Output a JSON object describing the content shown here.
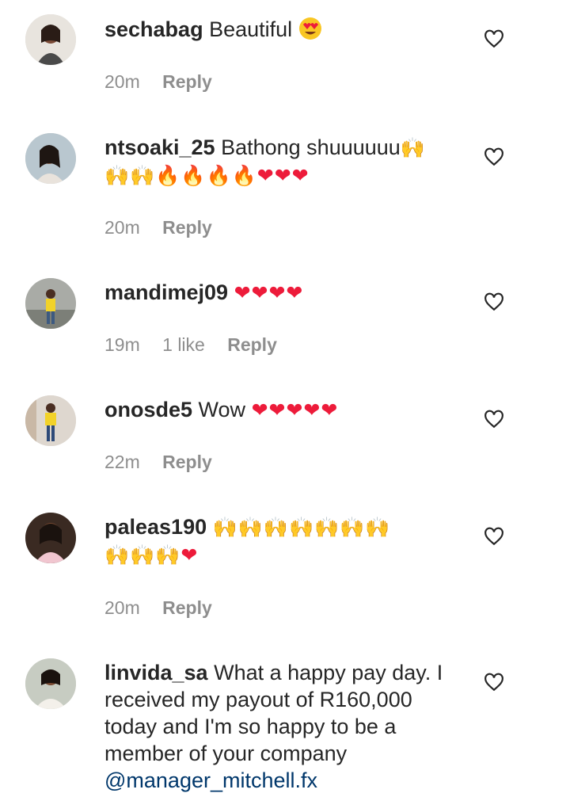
{
  "comments": [
    {
      "username": "sechabag",
      "text_lines": [
        "Beautiful"
      ],
      "emoji": "😍",
      "time": "20m",
      "likes": "",
      "reply": "Reply"
    },
    {
      "username": "ntsoaki_25",
      "text_lines": [
        "Bathong shuuuuuu"
      ],
      "emoji_line1": "🙌",
      "emoji_line2_hands": "🙌🙌",
      "emoji_line2_fire": "🔥🔥🔥🔥",
      "emoji_line2_hearts": "❤❤❤",
      "time": "20m",
      "likes": "",
      "reply": "Reply"
    },
    {
      "username": "mandimej09",
      "hearts": "❤❤❤❤",
      "time": "19m",
      "likes": "1 like",
      "reply": "Reply"
    },
    {
      "username": "onosde5",
      "text_lines": [
        "Wow"
      ],
      "hearts": "❤❤❤❤❤",
      "time": "22m",
      "likes": "",
      "reply": "Reply"
    },
    {
      "username": "paleas190",
      "hands_line1": "🙌🙌🙌🙌🙌🙌🙌",
      "hands_line2": "🙌🙌🙌",
      "heart": "❤",
      "time": "20m",
      "likes": "",
      "reply": "Reply"
    },
    {
      "username": "linvida_sa",
      "text_lines": [
        "What a happy pay day. I",
        "received my payout of R160,000",
        "today and I'm so happy to be a",
        "member of your company"
      ],
      "mention": "@manager_mitchell.fx"
    }
  ],
  "colors": {
    "username": "#262626",
    "meta": "#8e8e8e",
    "mention": "#00376b",
    "heart": "#ed1b3a"
  },
  "icons": {
    "like": "heart-outline-icon"
  }
}
